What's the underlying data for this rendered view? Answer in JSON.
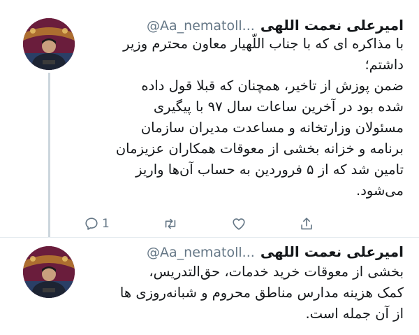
{
  "tweets": [
    {
      "author_name": "امیرعلی نعمت اللهی",
      "handle": "@Aa_nematoll...",
      "lines": [
        "با مذاکره ای که با جناب اللّهیار معاون محترم وزیر",
        "داشتم؛",
        "ضمن پوزش از تاخیر، همچنان که قبلا قول داده",
        "شده بود در آخرین ساعات سال ۹۷ با پیگیری",
        "مسئولان وزارتخانه و مساعدت مدیران سازمان",
        "برنامه و خزانه بخشی از معوقات همکاران عزیزمان",
        "تامین شد که از ۵ فروردین به حساب آن‌ها واریز",
        "می‌شود."
      ],
      "reply_count": "1",
      "icons": [
        "reply-icon",
        "retweet-icon",
        "like-icon",
        "share-icon"
      ]
    },
    {
      "author_name": "امیرعلی نعمت اللهی",
      "handle": "@Aa_nematoll...",
      "lines": [
        "بخشی از معوقات خرید خدمات، حق‌التدریس،",
        "کمک هزینه مدارس مناطق محروم و شبانه‌روزی ها",
        "از آن جمله است."
      ]
    }
  ],
  "colors": {
    "text": "#14171a",
    "secondary": "#657786",
    "thread_line": "#ccd6dd",
    "avatar_bg": "#6a1d3c"
  }
}
